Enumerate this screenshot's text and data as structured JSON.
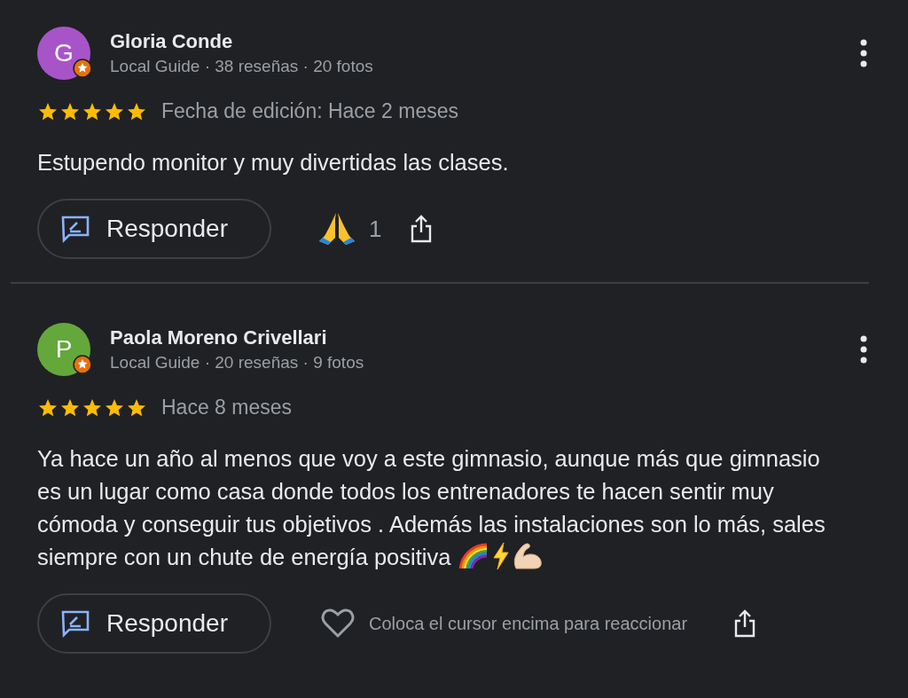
{
  "reviews": [
    {
      "initial": "G",
      "color": "#a854c9",
      "name": "Gloria Conde",
      "meta": "Local Guide · 38 reseñas · 20 fotos",
      "stars": 5,
      "date": "Fecha de edición: Hace 2 meses",
      "text": "Estupendo monitor y muy divertidas las clases.",
      "ends_with_emoji": false,
      "reply_label": "Responder",
      "reaction": {
        "kind": "emoji",
        "count": "1"
      }
    },
    {
      "initial": "P",
      "color": "#64a83c",
      "name": "Paola Moreno Crivellari",
      "meta": "Local Guide · 20 reseñas · 9 fotos",
      "stars": 5,
      "date": "Hace 8 meses",
      "text": "Ya hace un año al menos que voy a este gimnasio, aunque más que gimnasio es un lugar como casa donde todos los entrenadores te hacen sentir muy cómoda y conseguir tus objetivos . Además las instalaciones son lo más, sales siempre con un chute de energía positiva",
      "ends_with_emoji": true,
      "reply_label": "Responder",
      "reaction": {
        "kind": "hint",
        "text": "Coloca el cursor encima para reaccionar"
      }
    }
  ]
}
